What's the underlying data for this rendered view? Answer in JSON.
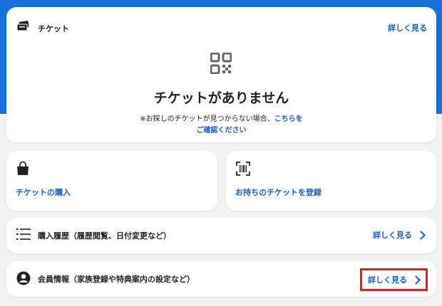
{
  "colors": {
    "accent_blue": "#1a6fd9",
    "link_blue": "#1a5fc4",
    "highlight_red": "#e31b23",
    "background": "#f2f2f2"
  },
  "ticket": {
    "title": "チケット",
    "more_label": "詳しく見る",
    "empty_title": "チケットがありません",
    "note_prefix": "※お探しのチケットが見つからない場合、",
    "note_link_1": "こちらを",
    "note_link_2": "ご確認ください",
    "header_icon": "ticket-icon",
    "empty_icon": "qr-code-icon"
  },
  "actions": {
    "buy_label": "チケットの購入",
    "buy_icon": "shopping-bag-icon",
    "register_label": "お持ちのチケットを登録",
    "register_icon": "barcode-scan-icon"
  },
  "history": {
    "label": "購入履歴（履歴閲覧、日付変更など）",
    "more_label": "詳しく見る",
    "icon": "list-icon"
  },
  "member": {
    "label": "会員情報（家族登録や特典案内の設定など）",
    "more_label": "詳しく見る",
    "icon": "user-icon"
  }
}
